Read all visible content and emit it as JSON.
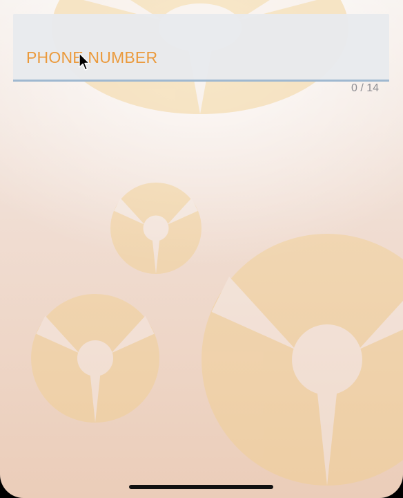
{
  "phone_field": {
    "label": "PHONE NUMBER",
    "value": "",
    "counter": "0 / 14"
  },
  "colors": {
    "label": "#eb9a3c",
    "underline": "#9fb8d0",
    "field_background": "#e8eaed",
    "counter": "#8e8e93"
  },
  "icons": [
    "fidget-spinner-icon",
    "mouse-pointer-icon"
  ]
}
